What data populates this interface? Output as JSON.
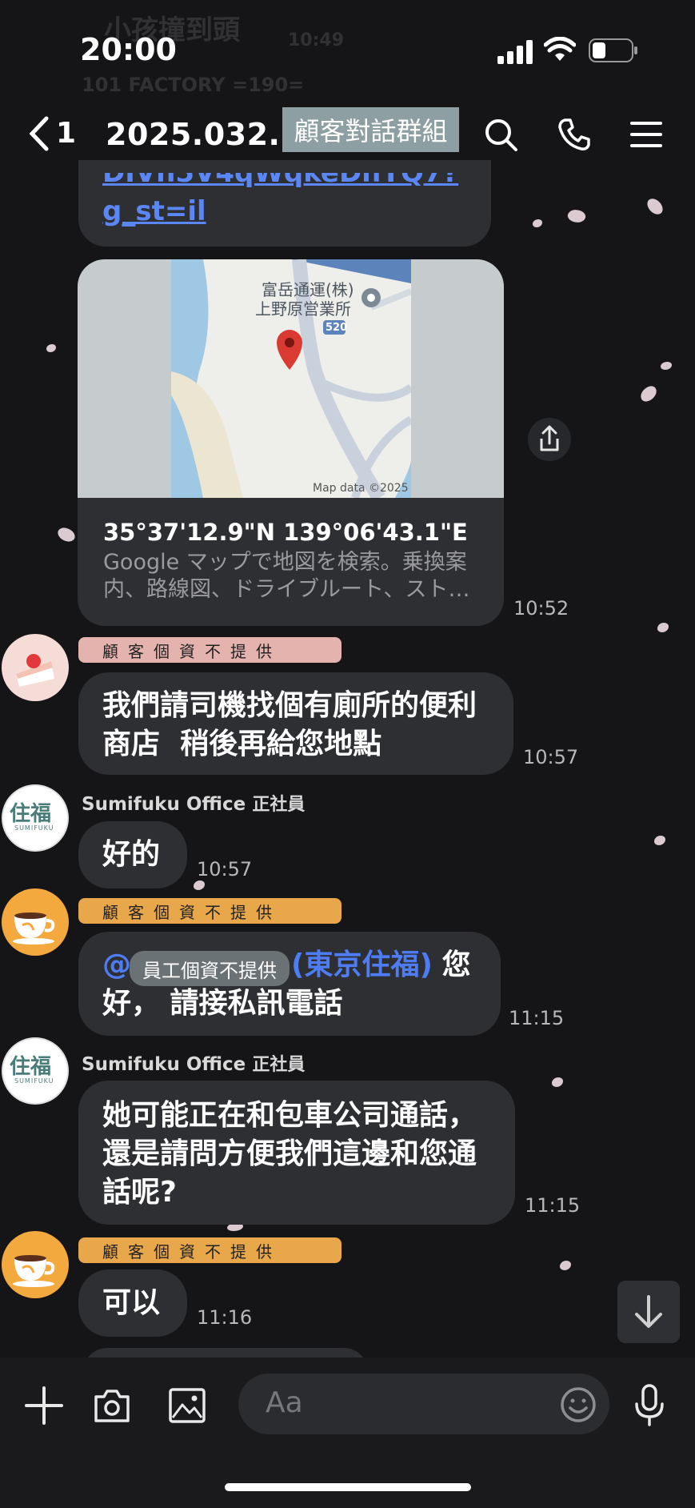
{
  "status_bar": {
    "time": "20:00"
  },
  "background_notifications": {
    "line1": "小孩撞到頭",
    "line1_time": "10:49",
    "line2": "101 FACTORY =190="
  },
  "header": {
    "back_count": "1",
    "title": "2025.032...",
    "overlay_label": "顧客對話群組"
  },
  "link_message": {
    "partial_url_line1": "DIVh5V4qWqkeDhYQ7?",
    "partial_url_line2": "g_st=il"
  },
  "map_card": {
    "map_label_line1": "富岳通運(株)",
    "map_label_line2": "上野原営業所",
    "road_number": "520",
    "map_credit": "Map data ©2025",
    "title": "35°37'12.9\"N 139°06'43.1\"E",
    "description": "Google マップで地図を検索。乗換案内、路線図、ドライブルート、スト…",
    "time": "10:52"
  },
  "messages": [
    {
      "sender_tag": "顧客個資不提供",
      "text_line1": "我們請司機找個有廁所的便利",
      "text_line2": "商店  稍後再給您地點",
      "time": "10:57"
    },
    {
      "sender": "Sumifuku Office",
      "sender_role": "正社員",
      "text": "好的",
      "time": "10:57"
    },
    {
      "sender_tag": "顧客個資不提供",
      "mention_prefix": "@",
      "mention_chip": "員工個資不提供",
      "mention_suffix": "(東京住福)",
      "text_tail": " 您",
      "text_line2": "好， 請接私訊電話",
      "time": "11:15"
    },
    {
      "sender": "Sumifuku Office",
      "sender_role": "正社員",
      "text_line1": "她可能正在和包車公司通話，",
      "text_line2": "還是請問方便我們這邊和您通",
      "text_line3": "話呢?",
      "time": "11:15"
    },
    {
      "sender_tag": "顧客個資不提供",
      "text": "可以",
      "time": "11:16"
    }
  ],
  "avatar_logo": {
    "kanji": "住福",
    "latin": "SUMIFUKU"
  },
  "input_bar": {
    "placeholder": "Aa"
  },
  "icons": [
    "chevron-left-icon",
    "search-icon",
    "phone-icon",
    "menu-icon",
    "share-icon",
    "scroll-down-icon",
    "plus-icon",
    "camera-icon",
    "image-icon",
    "emoji-icon",
    "microphone-icon"
  ],
  "colors": {
    "background": "#151517",
    "bubble": "#2e2f33",
    "tag_pink": "#e4b3ae",
    "tag_orange": "#e7a74a",
    "mention_blue": "#4e7cf3",
    "link_blue": "#5b86f5",
    "overlay_chip": "#8e9fa3"
  }
}
